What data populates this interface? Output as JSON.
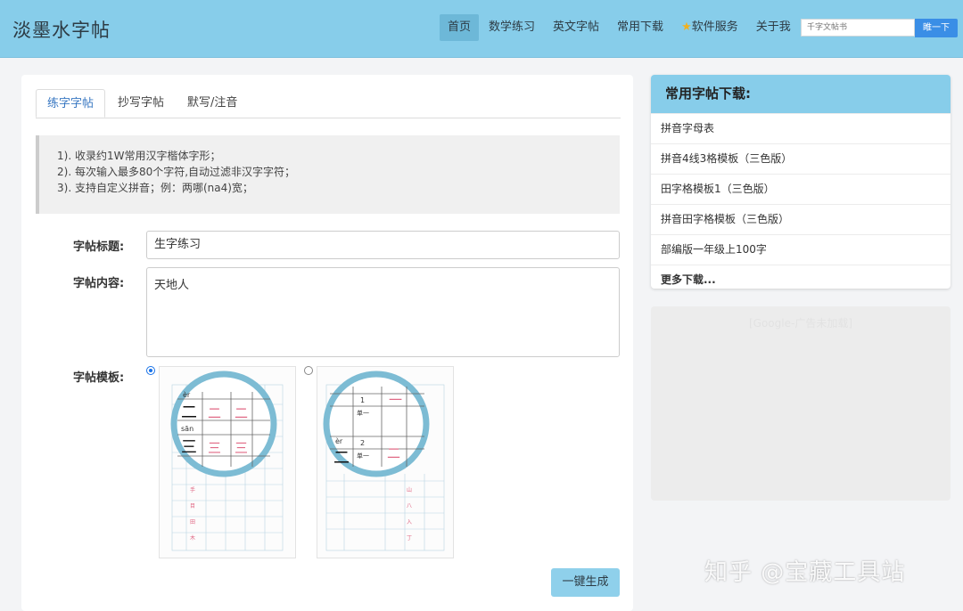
{
  "header": {
    "logo": "淡墨水字帖",
    "nav": [
      {
        "label": "首页",
        "active": true
      },
      {
        "label": "数学练习"
      },
      {
        "label": "英文字帖"
      },
      {
        "label": "常用下载"
      },
      {
        "label": "软件服务",
        "icon": "star-icon"
      },
      {
        "label": "关于我"
      }
    ],
    "search_placeholder": "千字文帖书",
    "search_button": "睢一下"
  },
  "tabs": [
    "练字字帖",
    "抄写字帖",
    "默写/注音"
  ],
  "notice": [
    "1). 收录约1W常用汉字楷体字形；",
    "2). 每次输入最多80个字符,自动过滤非汉字字符；",
    "3). 支持自定义拼音；例：两哪(na4)宽；"
  ],
  "form": {
    "title_label": "字帖标题:",
    "title_value": "生字练习",
    "content_label": "字帖内容:",
    "content_value": "天地人",
    "template_label": "字帖模板:",
    "templates": [
      {
        "selected": true,
        "pinyin_1": "èr",
        "pinyin_2": "sān"
      },
      {
        "selected": false,
        "pinyin": "èr",
        "digit_1": "1",
        "digit_2": "2",
        "stroke_label": "单一"
      }
    ]
  },
  "generate_button": "一键生成",
  "sidebar": {
    "title": "常用字帖下载:",
    "items": [
      "拼音字母表",
      "拼音4线3格模板（三色版）",
      "田字格模板1（三色版）",
      "拼音田字格模板（三色版）",
      "部编版一年级上100字",
      "更多下载..."
    ]
  },
  "ad_text": "[Google-广告未加载]",
  "watermark": "知乎 @宝藏工具站",
  "colors": {
    "header_bg": "#87cdea",
    "accent": "#3a8ee6",
    "button": "#8fd0eb",
    "magnifier_ring": "#7dbcd4"
  }
}
